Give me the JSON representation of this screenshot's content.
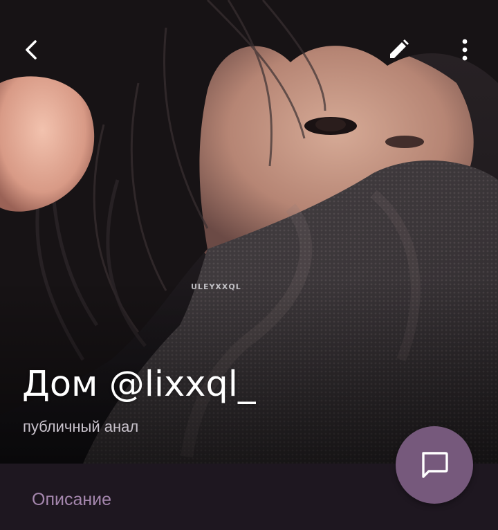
{
  "header": {
    "back_icon": "chevron-left-icon",
    "edit_icon": "pencil-icon",
    "more_icon": "more-vertical-icon"
  },
  "cover": {
    "watermark": "ULEYXXQL"
  },
  "channel": {
    "title": "Дом @lixxql_",
    "subtitle": "публичный анал"
  },
  "fab": {
    "icon": "message-icon"
  },
  "section": {
    "description_label": "Описание"
  },
  "colors": {
    "background": "#1e1720",
    "accent": "#a587ae",
    "fab": "#76597c",
    "title": "#ffffff",
    "subtitle": "#c9c3cc"
  }
}
